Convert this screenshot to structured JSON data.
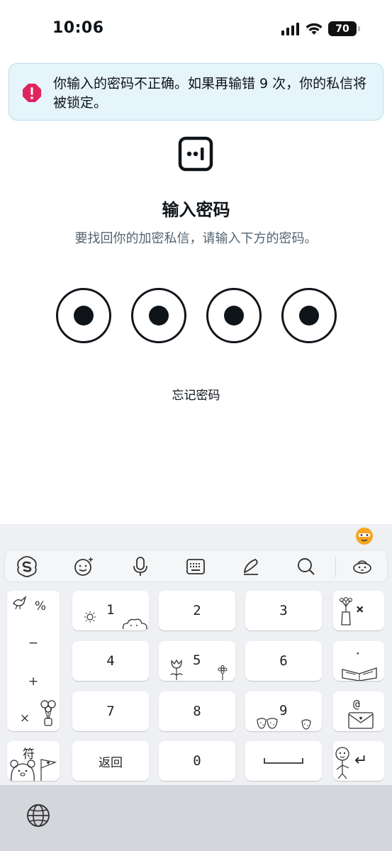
{
  "status_bar": {
    "time": "10:06",
    "battery": "70"
  },
  "error_banner": {
    "message": "你输入的密码不正确。如果再输错 9 次，你的私信将被锁定。",
    "color": "#e0245e"
  },
  "lock": {
    "title": "输入密码",
    "subtitle": "要找回你的加密私信，请输入下方的密码。",
    "pin_length": 4,
    "pin_filled": 4,
    "forgot_label": "忘记密码"
  },
  "keyboard": {
    "toolbar": [
      "sogou-logo-icon",
      "emoji-icon",
      "microphone-icon",
      "keyboard-icon",
      "handwriting-icon",
      "search-icon",
      "mascot-icon"
    ],
    "symbols": [
      "%",
      "−",
      "+",
      "×"
    ],
    "keys": {
      "k1": "1",
      "k2": "2",
      "k3": "3",
      "k4": "4",
      "k5": "5",
      "k6": "6",
      "k7": "7",
      "k8": "8",
      "k9": "9",
      "k0": "0",
      "delete": "×",
      "dot": "·",
      "at": "@",
      "symbols_toggle": "符",
      "back": "返回",
      "space": "⎵",
      "enter": "↵"
    }
  }
}
